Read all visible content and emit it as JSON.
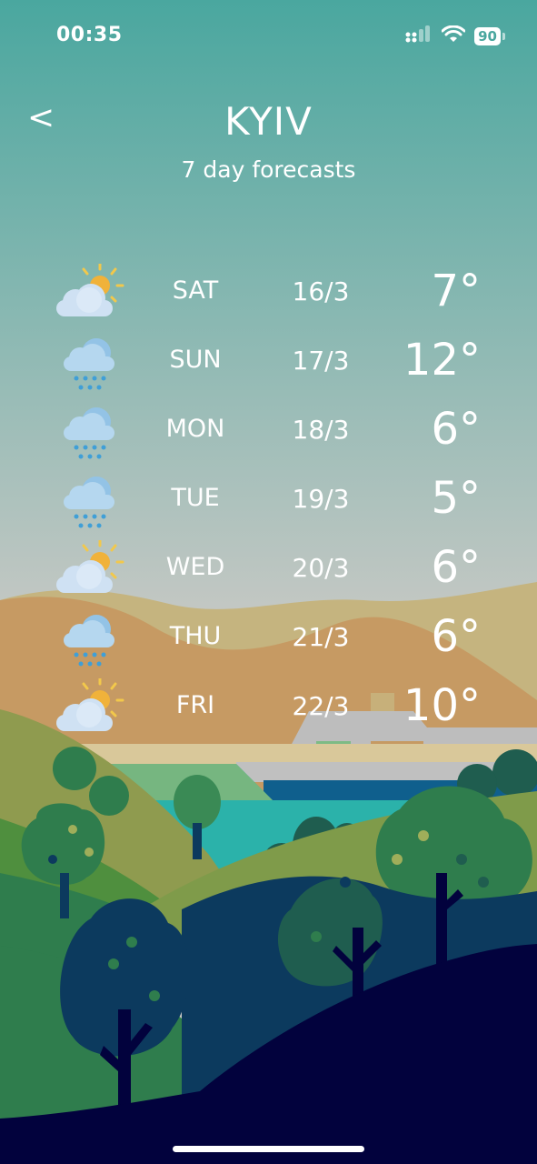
{
  "status_bar": {
    "time": "00:35",
    "battery": "90"
  },
  "header": {
    "back_label": "<",
    "city": "KYIV",
    "subtitle": "7 day forecasts"
  },
  "forecast": [
    {
      "day": "SAT",
      "date": "16/3",
      "temp": "7°",
      "icon": "partly-cloudy-icon"
    },
    {
      "day": "SUN",
      "date": "17/3",
      "temp": "12°",
      "icon": "rain-icon"
    },
    {
      "day": "MON",
      "date": "18/3",
      "temp": "6°",
      "icon": "rain-icon"
    },
    {
      "day": "TUE",
      "date": "19/3",
      "temp": "5°",
      "icon": "rain-icon"
    },
    {
      "day": "WED",
      "date": "20/3",
      "temp": "6°",
      "icon": "partly-cloudy-icon"
    },
    {
      "day": "THU",
      "date": "21/3",
      "temp": "6°",
      "icon": "rain-icon"
    },
    {
      "day": "FRI",
      "date": "22/3",
      "temp": "10°",
      "icon": "partly-cloudy-icon"
    }
  ],
  "colors": {
    "sky_top": "#4aa79f",
    "sky_bottom": "#c9c9c5",
    "hills_far": "#c69a63",
    "water": "#2bb2aa",
    "tree_dark": "#0c3a5e",
    "ground_dark": "#02023d"
  }
}
